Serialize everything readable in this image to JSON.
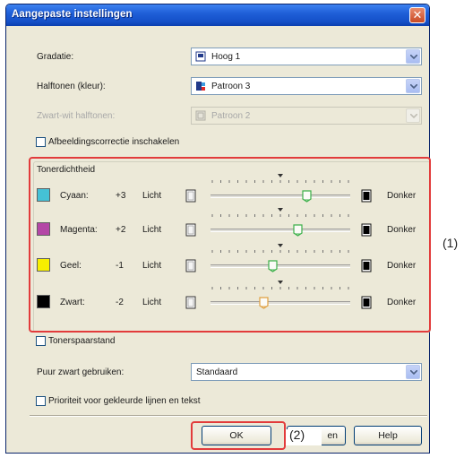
{
  "window": {
    "title": "Aangepaste instellingen"
  },
  "fields": {
    "gradatie_label": "Gradatie:",
    "gradatie_value": "Hoog 1",
    "halftonen_label": "Halftonen (kleur):",
    "halftonen_value": "Patroon 3",
    "zw_halftonen_label": "Zwart-wit halftonen:",
    "zw_halftonen_value": "Patroon 2",
    "beeldcorrectie_label": "Afbeeldingscorrectie inschakelen"
  },
  "toner": {
    "group_label": "Tonerdichtheid",
    "light_label": "Licht",
    "dark_label": "Donker",
    "rows": [
      {
        "name": "Cyaan:",
        "value": "+3",
        "color": "#45c1d6",
        "level": 3
      },
      {
        "name": "Magenta:",
        "value": "+2",
        "color": "#b446a6",
        "level": 2
      },
      {
        "name": "Geel:",
        "value": "-1",
        "color": "#f7ef00",
        "level": -1
      },
      {
        "name": "Zwart:",
        "value": "-2",
        "color": "#000000",
        "level": -2
      }
    ]
  },
  "options": {
    "tonerspaar_label": "Tonerspaarstand",
    "puur_zwart_label": "Puur zwart gebruiken:",
    "puur_zwart_value": "Standaard",
    "prioriteit_label": "Prioriteit voor gekleurde lijnen en tekst"
  },
  "buttons": {
    "ok": "OK",
    "cancel_partial": "en",
    "help": "Help"
  },
  "callouts": {
    "one": "(1)",
    "two": "(2)"
  },
  "colors": {
    "highlight": "#e23b3b",
    "titlebar": "#1f5fd8"
  }
}
